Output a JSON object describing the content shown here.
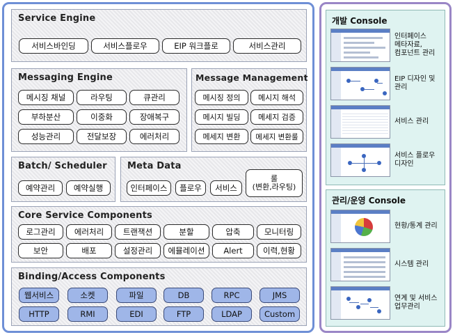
{
  "service_engine": {
    "title": "Service Engine",
    "items": [
      "서비스바인딩",
      "서비스플로우",
      "EIP 워크플로",
      "서비스관리"
    ]
  },
  "messaging_engine": {
    "title": "Messaging Engine",
    "items": [
      "메시징 채널",
      "라우팅",
      "큐관리",
      "부하분산",
      "이중화",
      "장애복구",
      "성능관리",
      "전달보장",
      "에러처리"
    ]
  },
  "message_management": {
    "title": "Message Management",
    "items": [
      "메시징 정의",
      "메시지 해석",
      "메시지 빌딩",
      "메세지 검증",
      "메세지 변환",
      "메세지 변환룰"
    ]
  },
  "batch_scheduler": {
    "title": "Batch/ Scheduler",
    "items": [
      "예약관리",
      "예약실행"
    ]
  },
  "meta_data": {
    "title": "Meta Data",
    "items": [
      "인터페이스",
      "플로우",
      "서비스"
    ],
    "rule_line1": "룰",
    "rule_line2": "(변환,라우팅)"
  },
  "core_service": {
    "title": "Core Service Components",
    "items": [
      "로그관리",
      "에러처리",
      "트랜잭션",
      "분할",
      "압축",
      "모니터링",
      "보안",
      "배포",
      "설정관리",
      "에뮬레이션",
      "Alert",
      "이력,현황"
    ]
  },
  "binding_access": {
    "title": "Binding/Access Components",
    "items": [
      "웹서비스",
      "소켓",
      "파일",
      "DB",
      "RPC",
      "JMS",
      "HTTP",
      "RMI",
      "EDI",
      "FTP",
      "LDAP",
      "Custom"
    ]
  },
  "dev_console": {
    "title": "개발 Console",
    "items": [
      {
        "lines": [
          "인터페이스",
          "메타자료,",
          "컴포넌트 관리"
        ],
        "icon": "interface-screenshot"
      },
      {
        "lines": [
          "EIP 디자인 및",
          "관리"
        ],
        "icon": "eip-design-screenshot"
      },
      {
        "lines": [
          "서비스 관리"
        ],
        "icon": "service-manage-screenshot"
      },
      {
        "lines": [
          "서비스 플로우",
          "디자인"
        ],
        "icon": "flow-design-screenshot"
      }
    ]
  },
  "ops_console": {
    "title": "관리/운영 Console",
    "items": [
      {
        "lines": [
          "현황/통계 관리"
        ],
        "icon": "stats-chart-screenshot"
      },
      {
        "lines": [
          "시스템 관리"
        ],
        "icon": "system-screenshot"
      },
      {
        "lines": [
          "연계 및 서비스",
          "업무관리"
        ],
        "icon": "workflow-screenshot"
      }
    ]
  },
  "colors": {
    "left_frame": "#6e8fd6",
    "right_frame": "#9a86c6",
    "console_bg": "#dff3f1",
    "binding_chip": "#9fb6e8"
  }
}
